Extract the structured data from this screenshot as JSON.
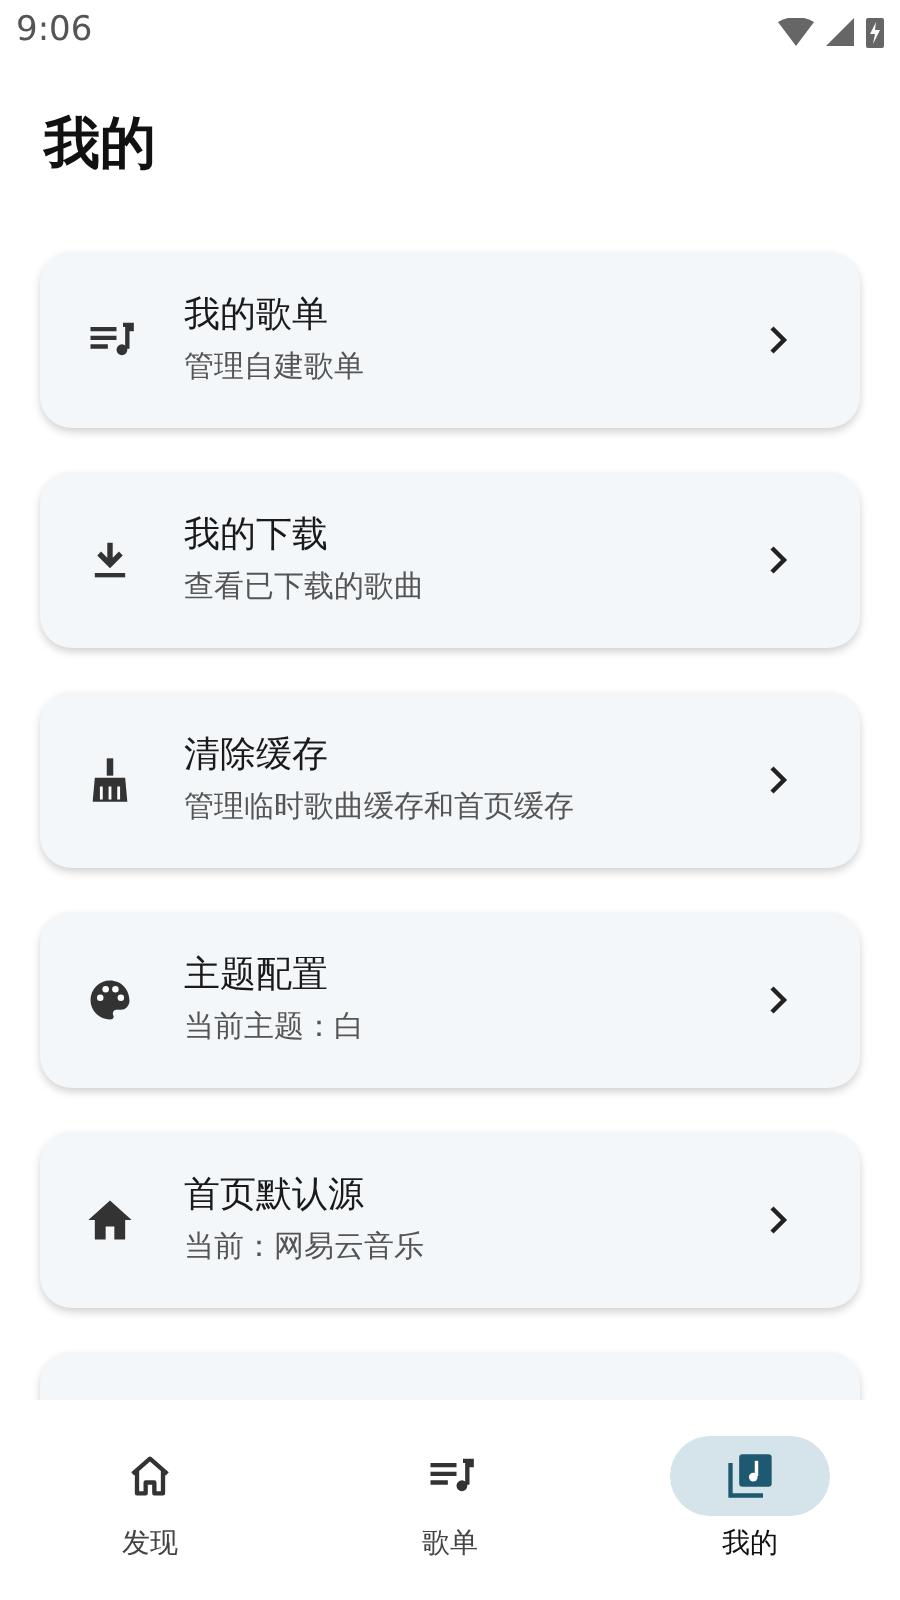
{
  "status_bar": {
    "time": "9:06"
  },
  "title": "我的",
  "items": [
    {
      "title": "我的歌单",
      "subtitle": "管理自建歌单"
    },
    {
      "title": "我的下载",
      "subtitle": "查看已下载的歌曲"
    },
    {
      "title": "清除缓存",
      "subtitle": "管理临时歌曲缓存和首页缓存"
    },
    {
      "title": "主题配置",
      "subtitle": "当前主题：白"
    },
    {
      "title": "首页默认源",
      "subtitle": "当前：网易云音乐"
    }
  ],
  "nav": [
    {
      "label": "发现",
      "selected": false
    },
    {
      "label": "歌单",
      "selected": false
    },
    {
      "label": "我的",
      "selected": true
    }
  ]
}
